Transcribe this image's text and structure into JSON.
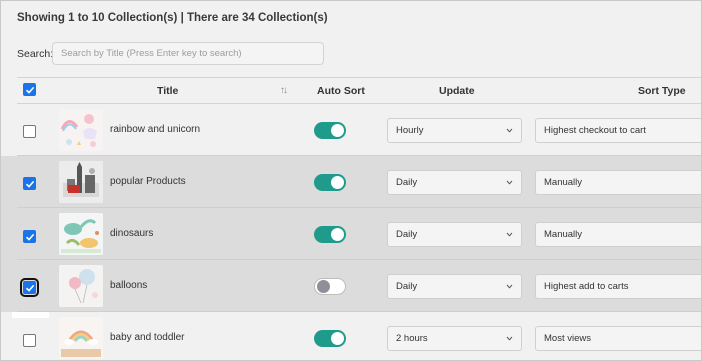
{
  "summary": "Showing 1 to 10 Collection(s) | There are 34 Collection(s)",
  "search": {
    "label": "Search:",
    "placeholder": "Search by Title (Press Enter key to search)"
  },
  "table": {
    "headers": {
      "title": "Title",
      "auto_sort": "Auto Sort",
      "update": "Update",
      "sort_type": "Sort Type"
    },
    "select_all_checked": true,
    "rows": [
      {
        "title": "rainbow and unicorn",
        "checked": false,
        "selected": false,
        "auto_sort": true,
        "update": "Hourly",
        "sort_type": "Highest checkout to cart",
        "thumb": "unicorn-wall-decal"
      },
      {
        "title": "popular Products",
        "checked": true,
        "selected": true,
        "auto_sort": true,
        "update": "Daily",
        "sort_type": "Manually",
        "thumb": "london-city-decal"
      },
      {
        "title": "dinosaurs",
        "checked": true,
        "selected": true,
        "auto_sort": true,
        "update": "Daily",
        "sort_type": "Manually",
        "thumb": "dinosaur-wall-decal"
      },
      {
        "title": "balloons",
        "checked": true,
        "selected": true,
        "focused": true,
        "auto_sort": false,
        "update": "Daily",
        "sort_type": "Highest add to carts",
        "thumb": "balloon-wall-decal"
      },
      {
        "title": "baby and toddler",
        "checked": false,
        "selected": false,
        "auto_sort": true,
        "update": "2 hours",
        "sort_type": "Most views",
        "thumb": "rainbow-wall-decal"
      }
    ]
  },
  "colors": {
    "accent_blue": "#1a73e8",
    "toggle_on": "#1f9a8b",
    "selected_row": "#dcdcdc"
  }
}
